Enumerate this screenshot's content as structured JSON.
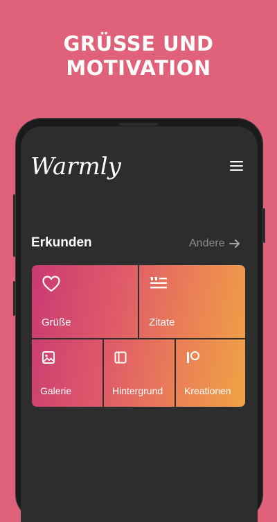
{
  "headline": {
    "line1": "GRÜSSE UND",
    "line2": "MOTIVATION"
  },
  "app": {
    "logo": "Warmly",
    "menu_icon": "hamburger-menu-icon"
  },
  "explore": {
    "title": "Erkunden",
    "more_label": "Andere",
    "more_icon": "arrow-right-icon"
  },
  "tiles": [
    {
      "label": "Grüße",
      "icon": "heart-icon"
    },
    {
      "label": "Zitate",
      "icon": "quote-icon"
    },
    {
      "label": "Galerie",
      "icon": "image-icon"
    },
    {
      "label": "Hintergrund",
      "icon": "wallpaper-icon"
    },
    {
      "label": "Kreationen",
      "icon": "patreon-icon"
    }
  ],
  "colors": {
    "background": "#e0617a",
    "screen": "#2d2d2d",
    "gradient_start": "#c93a73",
    "gradient_end": "#f0a444"
  }
}
